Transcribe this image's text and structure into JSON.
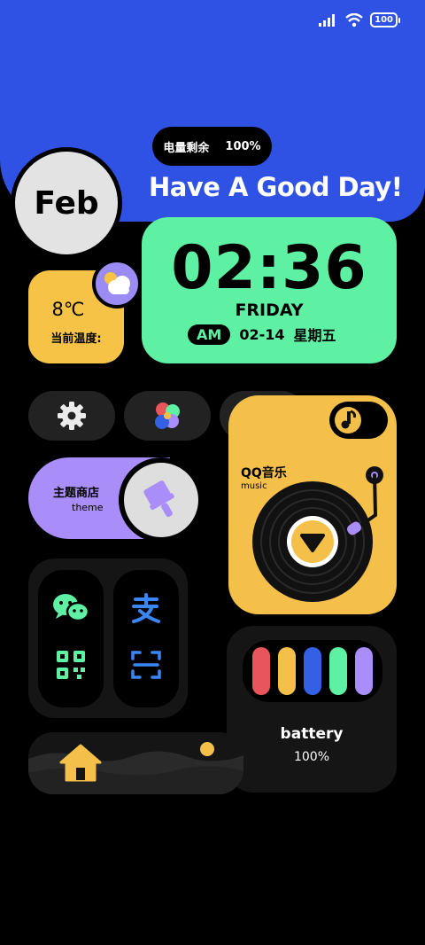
{
  "status_bar": {
    "battery": "100"
  },
  "battery_remaining": {
    "label": "电量剩余",
    "value": "100%"
  },
  "greeting": "Have A Good Day!",
  "month": "Feb",
  "clock": {
    "time": "02:36",
    "weekday": "FRIDAY",
    "ampm": "AM",
    "date": "02-14",
    "weekday_cn": "星期五"
  },
  "weather": {
    "temp": "8℃",
    "label": "当前温度:"
  },
  "apps": [
    {
      "icon": "settings-gear-icon"
    },
    {
      "icon": "gallery-dots-icon"
    },
    {
      "icon": "music-note-icon"
    }
  ],
  "theme_store": {
    "title": "主题商店",
    "subtitle": "theme"
  },
  "music": {
    "title": "QQ音乐",
    "subtitle": "music"
  },
  "battery_widget": {
    "label": "battery",
    "value": "100%",
    "bar_colors": [
      "#e8555b",
      "#f5c04a",
      "#3460e6",
      "#5ef0a3",
      "#a98df8"
    ]
  },
  "colors": {
    "banner": "#2f52e4",
    "clock_card": "#5ef0a3",
    "weather_card": "#f7c347",
    "theme_card": "#a98df8",
    "music_card": "#f5c04a"
  }
}
